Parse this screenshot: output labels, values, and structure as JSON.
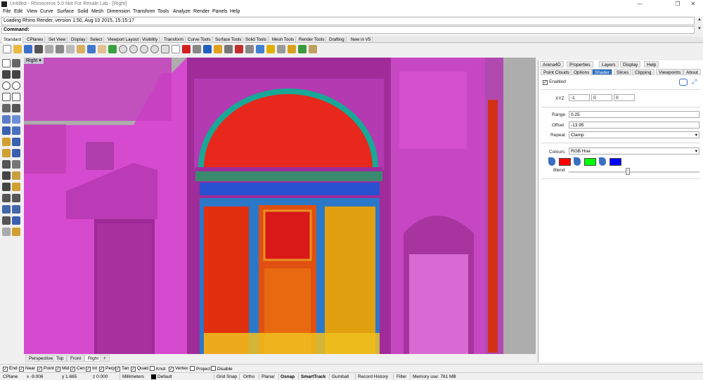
{
  "window": {
    "title": "Untitled - Rhinoceros 5.0 Not For Resale Lab - [Right]"
  },
  "menu": [
    "File",
    "Edit",
    "View",
    "Curve",
    "Surface",
    "Solid",
    "Mesh",
    "Dimension",
    "Transform",
    "Tools",
    "Analyze",
    "Render",
    "Panels",
    "Help"
  ],
  "command": {
    "history": "Loading Rhino Render, version 1.50, Aug 10 2015, 15:15:17",
    "prompt": "Command:"
  },
  "toolbar_tabs": [
    "Standard",
    "CPlanes",
    "Set View",
    "Display",
    "Select",
    "Viewport Layout",
    "Visibility",
    "Transform",
    "Curve Tools",
    "Surface Tools",
    "Solid Tools",
    "Mesh Tools",
    "Render Tools",
    "Drafting",
    "New in V5"
  ],
  "viewport": {
    "label": "Right",
    "tabs": [
      "Perspective",
      "Top",
      "Front",
      "Right"
    ],
    "add_tab": "+"
  },
  "panel": {
    "top_tabs": [
      "Arena4D",
      "Properties",
      "Layers",
      "Display",
      "Help"
    ],
    "sub_tabs": [
      "Point Clouds",
      "Options",
      "Shader",
      "Slices",
      "Clipping",
      "Viewpoints",
      "About"
    ],
    "active_sub_tab": "Shader",
    "enabled_label": "Enabled",
    "enabled": true,
    "xyz_label": "XYZ",
    "xyz": [
      "-1",
      "0",
      "0"
    ],
    "range_label": "Range",
    "range": "0.25",
    "offset_label": "Offset",
    "offset": "-13.95",
    "repeat_label": "Repeat",
    "repeat": "Clamp",
    "colours_label": "Colours",
    "colours": "RGB Hue",
    "swatch_colors": [
      "#ff0000",
      "#00ff00",
      "#0000ff"
    ],
    "blend_label": "Blend",
    "blend_value": 0.45
  },
  "osnaps": [
    {
      "label": "End",
      "checked": true
    },
    {
      "label": "Near",
      "checked": true
    },
    {
      "label": "Point",
      "checked": true
    },
    {
      "label": "Mid",
      "checked": true
    },
    {
      "label": "Cen",
      "checked": true
    },
    {
      "label": "Int",
      "checked": true
    },
    {
      "label": "Perp",
      "checked": true
    },
    {
      "label": "Tan",
      "checked": true
    },
    {
      "label": "Quad",
      "checked": true
    },
    {
      "label": "Knot",
      "checked": false
    },
    {
      "label": "Vertex",
      "checked": true
    },
    {
      "label": "Project",
      "checked": false
    },
    {
      "label": "Disable",
      "checked": false
    }
  ],
  "status": {
    "cplane": "CPlane",
    "x": "x -9.006",
    "y": "y 1.665",
    "z": "z 0.000",
    "units": "Millimeters",
    "layer": "Default",
    "grid_snap": "Grid Snap",
    "ortho": "Ortho",
    "planar": "Planar",
    "osnap": "Osnap",
    "smarttrack": "SmartTrack",
    "gumball": "Gumball",
    "record_history": "Record History",
    "filter": "Filter",
    "memory": "Memory use: 761 MB"
  },
  "colors": {
    "magenta": "#d040c8",
    "panel_accent": "#2a6fc2",
    "viewport_bg": "#adadad"
  }
}
